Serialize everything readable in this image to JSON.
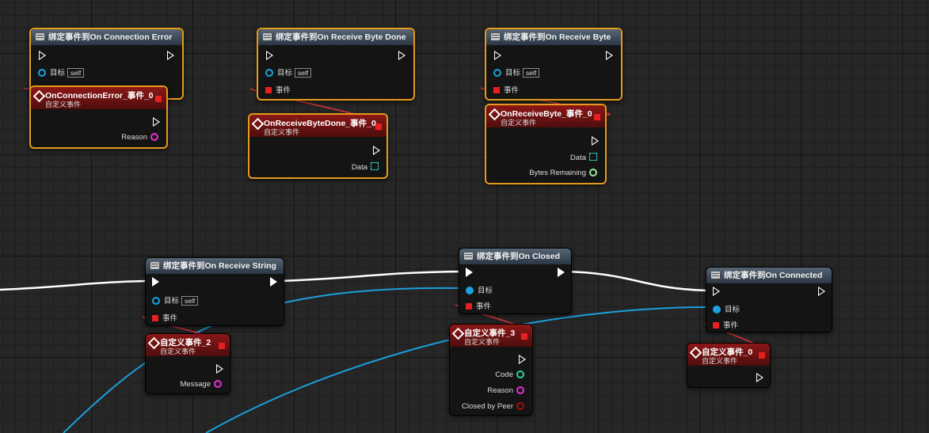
{
  "nodes": {
    "bind_connection_error": {
      "title": "绑定事件到On Connection Error",
      "target_label": "目标",
      "self_label": "self",
      "event_label": "事件"
    },
    "evt_connection_error": {
      "title": "OnConnectionError_事件_0",
      "subtitle": "自定义事件",
      "out_label": "Reason"
    },
    "bind_receive_byte_done": {
      "title": "绑定事件到On Receive Byte Done",
      "target_label": "目标",
      "self_label": "self",
      "event_label": "事件"
    },
    "evt_receive_byte_done": {
      "title": "OnReceiveByteDone_事件_0",
      "subtitle": "自定义事件",
      "out_label": "Data"
    },
    "bind_receive_byte": {
      "title": "绑定事件到On Receive Byte",
      "target_label": "目标",
      "self_label": "self",
      "event_label": "事件"
    },
    "evt_receive_byte": {
      "title": "OnReceiveByte_事件_0",
      "subtitle": "自定义事件",
      "out_data": "Data",
      "out_remaining": "Bytes Remaining"
    },
    "bind_receive_string": {
      "title": "绑定事件到On Receive String",
      "target_label": "目标",
      "self_label": "self",
      "event_label": "事件"
    },
    "evt_custom_2": {
      "title": "自定义事件_2",
      "subtitle": "自定义事件",
      "out_label": "Message"
    },
    "bind_closed": {
      "title": "绑定事件到On Closed",
      "target_label": "目标",
      "event_label": "事件"
    },
    "evt_custom_3": {
      "title": "自定义事件_3",
      "subtitle": "自定义事件",
      "out_code": "Code",
      "out_reason": "Reason",
      "out_closed": "Closed by Peer"
    },
    "bind_connected": {
      "title": "绑定事件到On Connected",
      "target_label": "目标",
      "event_label": "事件"
    },
    "evt_custom_0": {
      "title": "自定义事件_0",
      "subtitle": "自定义事件"
    }
  },
  "colors": {
    "exec_wire": "#ffffff",
    "object_wire": "#1a9fd9",
    "delegate_wire": "#e0343a",
    "selection": "#e59a1c",
    "string_pin": "#e830d8",
    "int_pin": "#2bd4a8",
    "bool_pin": "#a00e0e"
  }
}
